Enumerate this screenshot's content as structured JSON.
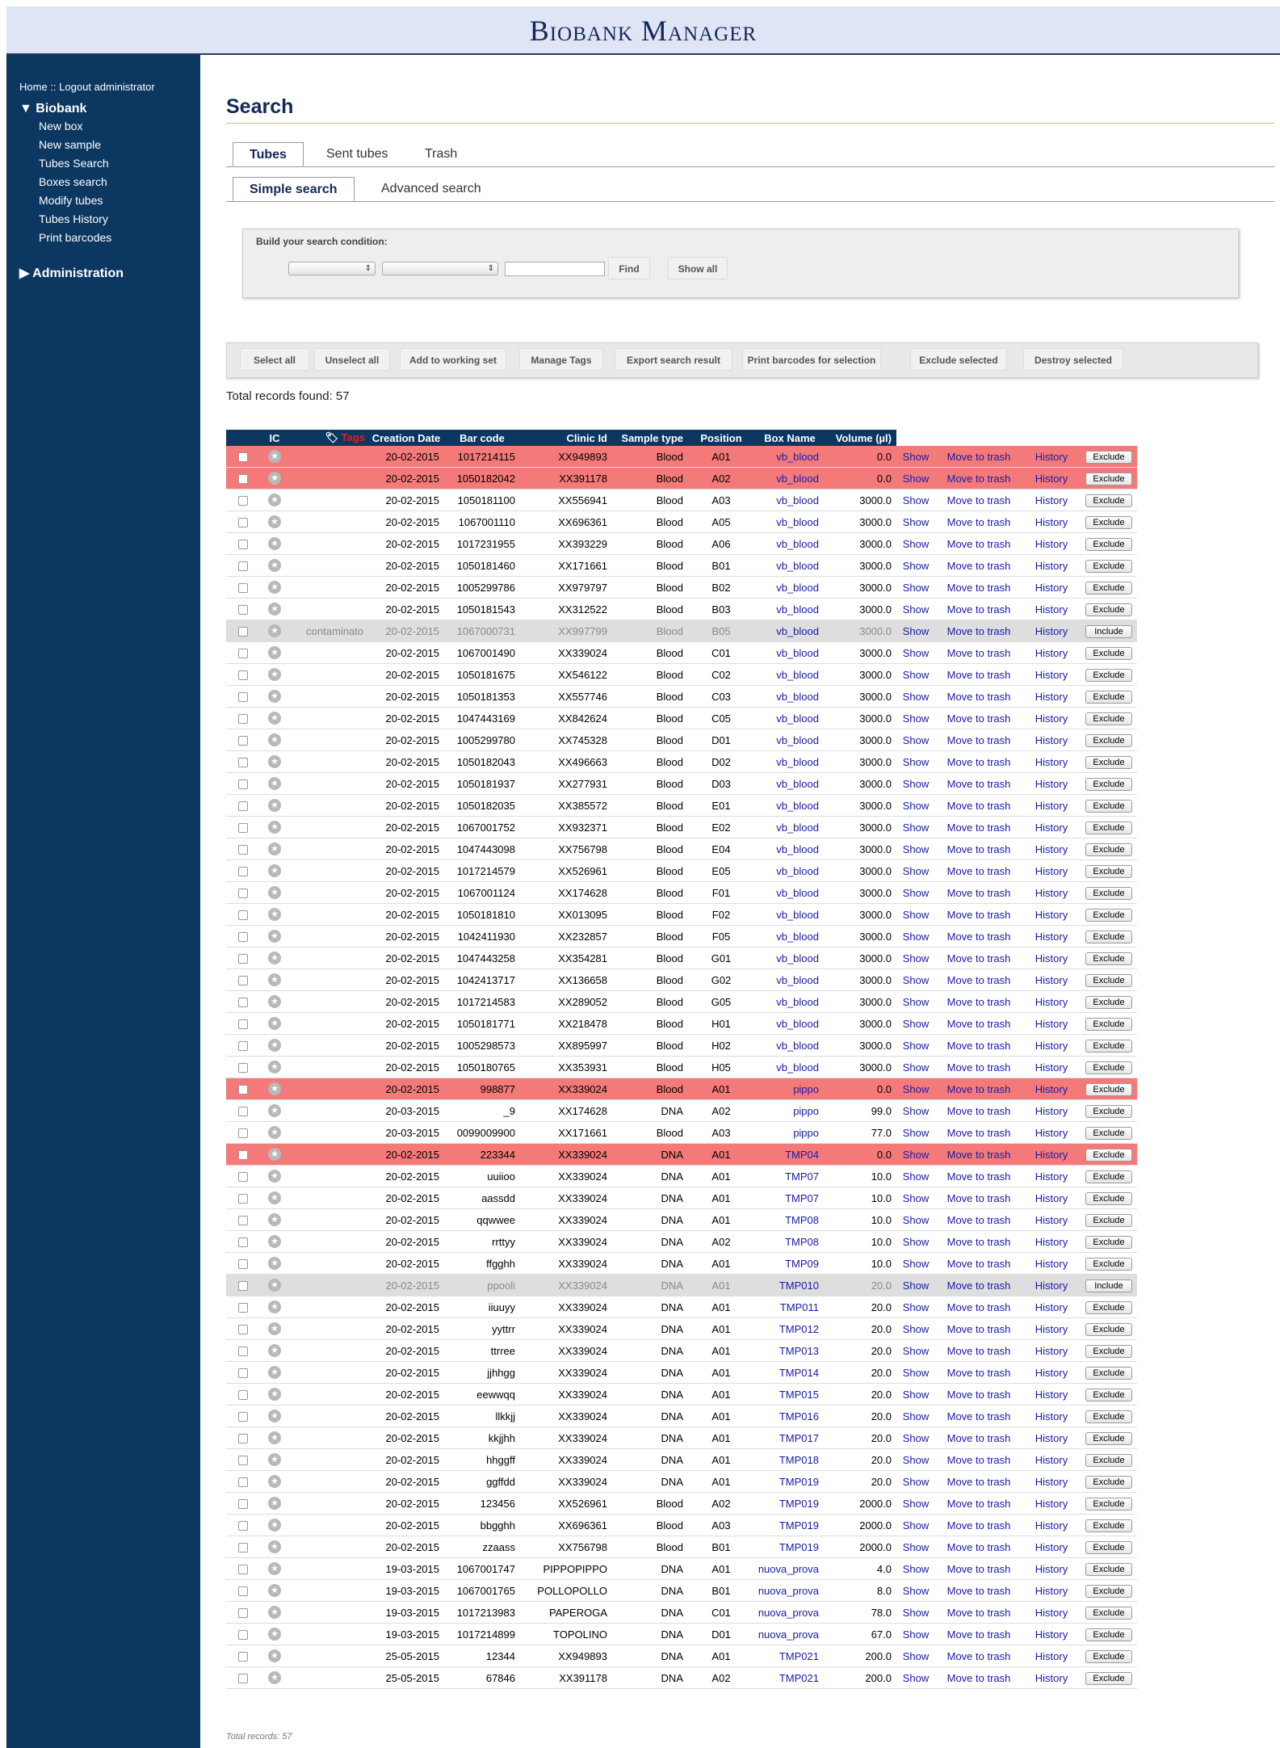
{
  "app": {
    "title": "Biobank Manager"
  },
  "sidebar": {
    "home": "Home",
    "separator": "::",
    "logout": "Logout administrator",
    "biobank": {
      "label": "▼ Biobank",
      "items": [
        "New box",
        "New sample",
        "Tubes Search",
        "Boxes search",
        "Modify tubes",
        "Tubes History",
        "Print barcodes"
      ]
    },
    "administration": {
      "label": "▶ Administration"
    }
  },
  "page": {
    "title": "Search"
  },
  "tabs": {
    "tubes": "Tubes",
    "sent": "Sent tubes",
    "trash": "Trash"
  },
  "subtabs": {
    "simple": "Simple search",
    "advanced": "Advanced search"
  },
  "search": {
    "label": "Build your search condition:",
    "select1_value": "",
    "select2_value": "",
    "text_value": "",
    "find": "Find",
    "show_all": "Show all"
  },
  "actions": [
    "Select all",
    "Unselect all",
    "Add to working set",
    "Manage Tags",
    "Export search result",
    "Print barcodes for selection",
    "Exclude selected",
    "Destroy selected"
  ],
  "total_label": "Total records found: 57",
  "columns": [
    "IC",
    "Tags",
    "Creation Date",
    "Bar code",
    "Clinic Id",
    "Sample type",
    "Position",
    "Box Name",
    "Volume (µl)"
  ],
  "row_links": {
    "show": "Show",
    "trash": "Move to trash",
    "history": "History"
  },
  "colors": {
    "header_bg": "#0b3761",
    "red_row": "#f47a7a",
    "excluded_row": "#dedede",
    "link": "#1a1aa8"
  },
  "rows": [
    [
      "20-02-2015",
      "1017214115",
      "XX949893",
      "Blood",
      "A01",
      "vb_blood",
      "0.0",
      "",
      "red",
      "Exclude"
    ],
    [
      "20-02-2015",
      "1050182042",
      "XX391178",
      "Blood",
      "A02",
      "vb_blood",
      "0.0",
      "",
      "red",
      "Exclude"
    ],
    [
      "20-02-2015",
      "1050181100",
      "XX556941",
      "Blood",
      "A03",
      "vb_blood",
      "3000.0",
      "",
      "",
      "Exclude"
    ],
    [
      "20-02-2015",
      "1067001110",
      "XX696361",
      "Blood",
      "A05",
      "vb_blood",
      "3000.0",
      "",
      "",
      "Exclude"
    ],
    [
      "20-02-2015",
      "1017231955",
      "XX393229",
      "Blood",
      "A06",
      "vb_blood",
      "3000.0",
      "",
      "",
      "Exclude"
    ],
    [
      "20-02-2015",
      "1050181460",
      "XX171661",
      "Blood",
      "B01",
      "vb_blood",
      "3000.0",
      "",
      "",
      "Exclude"
    ],
    [
      "20-02-2015",
      "1005299786",
      "XX979797",
      "Blood",
      "B02",
      "vb_blood",
      "3000.0",
      "",
      "",
      "Exclude"
    ],
    [
      "20-02-2015",
      "1050181543",
      "XX312522",
      "Blood",
      "B03",
      "vb_blood",
      "3000.0",
      "",
      "",
      "Exclude"
    ],
    [
      "20-02-2015",
      "1067000731",
      "XX997799",
      "Blood",
      "B05",
      "vb_blood",
      "3000.0",
      "contaminato",
      "gray",
      "Include"
    ],
    [
      "20-02-2015",
      "1067001490",
      "XX339024",
      "Blood",
      "C01",
      "vb_blood",
      "3000.0",
      "",
      "",
      "Exclude"
    ],
    [
      "20-02-2015",
      "1050181675",
      "XX546122",
      "Blood",
      "C02",
      "vb_blood",
      "3000.0",
      "",
      "",
      "Exclude"
    ],
    [
      "20-02-2015",
      "1050181353",
      "XX557746",
      "Blood",
      "C03",
      "vb_blood",
      "3000.0",
      "",
      "",
      "Exclude"
    ],
    [
      "20-02-2015",
      "1047443169",
      "XX842624",
      "Blood",
      "C05",
      "vb_blood",
      "3000.0",
      "",
      "",
      "Exclude"
    ],
    [
      "20-02-2015",
      "1005299780",
      "XX745328",
      "Blood",
      "D01",
      "vb_blood",
      "3000.0",
      "",
      "",
      "Exclude"
    ],
    [
      "20-02-2015",
      "1050182043",
      "XX496663",
      "Blood",
      "D02",
      "vb_blood",
      "3000.0",
      "",
      "",
      "Exclude"
    ],
    [
      "20-02-2015",
      "1050181937",
      "XX277931",
      "Blood",
      "D03",
      "vb_blood",
      "3000.0",
      "",
      "",
      "Exclude"
    ],
    [
      "20-02-2015",
      "1050182035",
      "XX385572",
      "Blood",
      "E01",
      "vb_blood",
      "3000.0",
      "",
      "",
      "Exclude"
    ],
    [
      "20-02-2015",
      "1067001752",
      "XX932371",
      "Blood",
      "E02",
      "vb_blood",
      "3000.0",
      "",
      "",
      "Exclude"
    ],
    [
      "20-02-2015",
      "1047443098",
      "XX756798",
      "Blood",
      "E04",
      "vb_blood",
      "3000.0",
      "",
      "",
      "Exclude"
    ],
    [
      "20-02-2015",
      "1017214579",
      "XX526961",
      "Blood",
      "E05",
      "vb_blood",
      "3000.0",
      "",
      "",
      "Exclude"
    ],
    [
      "20-02-2015",
      "1067001124",
      "XX174628",
      "Blood",
      "F01",
      "vb_blood",
      "3000.0",
      "",
      "",
      "Exclude"
    ],
    [
      "20-02-2015",
      "1050181810",
      "XX013095",
      "Blood",
      "F02",
      "vb_blood",
      "3000.0",
      "",
      "",
      "Exclude"
    ],
    [
      "20-02-2015",
      "1042411930",
      "XX232857",
      "Blood",
      "F05",
      "vb_blood",
      "3000.0",
      "",
      "",
      "Exclude"
    ],
    [
      "20-02-2015",
      "1047443258",
      "XX354281",
      "Blood",
      "G01",
      "vb_blood",
      "3000.0",
      "",
      "",
      "Exclude"
    ],
    [
      "20-02-2015",
      "1042413717",
      "XX136658",
      "Blood",
      "G02",
      "vb_blood",
      "3000.0",
      "",
      "",
      "Exclude"
    ],
    [
      "20-02-2015",
      "1017214583",
      "XX289052",
      "Blood",
      "G05",
      "vb_blood",
      "3000.0",
      "",
      "",
      "Exclude"
    ],
    [
      "20-02-2015",
      "1050181771",
      "XX218478",
      "Blood",
      "H01",
      "vb_blood",
      "3000.0",
      "",
      "",
      "Exclude"
    ],
    [
      "20-02-2015",
      "1005298573",
      "XX895997",
      "Blood",
      "H02",
      "vb_blood",
      "3000.0",
      "",
      "",
      "Exclude"
    ],
    [
      "20-02-2015",
      "1050180765",
      "XX353931",
      "Blood",
      "H05",
      "vb_blood",
      "3000.0",
      "",
      "",
      "Exclude"
    ],
    [
      "20-02-2015",
      "998877",
      "XX339024",
      "Blood",
      "A01",
      "pippo",
      "0.0",
      "",
      "red",
      "Exclude"
    ],
    [
      "20-03-2015",
      "_9",
      "XX174628",
      "DNA",
      "A02",
      "pippo",
      "99.0",
      "",
      "",
      "Exclude"
    ],
    [
      "20-03-2015",
      "0099009900",
      "XX171661",
      "Blood",
      "A03",
      "pippo",
      "77.0",
      "",
      "",
      "Exclude"
    ],
    [
      "20-02-2015",
      "223344",
      "XX339024",
      "DNA",
      "A01",
      "TMP04",
      "0.0",
      "",
      "red",
      "Exclude"
    ],
    [
      "20-02-2015",
      "uuiioo",
      "XX339024",
      "DNA",
      "A01",
      "TMP07",
      "10.0",
      "",
      "",
      "Exclude"
    ],
    [
      "20-02-2015",
      "aassdd",
      "XX339024",
      "DNA",
      "A01",
      "TMP07",
      "10.0",
      "",
      "",
      "Exclude"
    ],
    [
      "20-02-2015",
      "qqwwee",
      "XX339024",
      "DNA",
      "A01",
      "TMP08",
      "10.0",
      "",
      "",
      "Exclude"
    ],
    [
      "20-02-2015",
      "rrttyy",
      "XX339024",
      "DNA",
      "A02",
      "TMP08",
      "10.0",
      "",
      "",
      "Exclude"
    ],
    [
      "20-02-2015",
      "ffgghh",
      "XX339024",
      "DNA",
      "A01",
      "TMP09",
      "10.0",
      "",
      "",
      "Exclude"
    ],
    [
      "20-02-2015",
      "ppooli",
      "XX339024",
      "DNA",
      "A01",
      "TMP010",
      "20.0",
      "",
      "gray",
      "Include"
    ],
    [
      "20-02-2015",
      "iiuuyy",
      "XX339024",
      "DNA",
      "A01",
      "TMP011",
      "20.0",
      "",
      "",
      "Exclude"
    ],
    [
      "20-02-2015",
      "yyttrr",
      "XX339024",
      "DNA",
      "A01",
      "TMP012",
      "20.0",
      "",
      "",
      "Exclude"
    ],
    [
      "20-02-2015",
      "ttrree",
      "XX339024",
      "DNA",
      "A01",
      "TMP013",
      "20.0",
      "",
      "",
      "Exclude"
    ],
    [
      "20-02-2015",
      "jjhhgg",
      "XX339024",
      "DNA",
      "A01",
      "TMP014",
      "20.0",
      "",
      "",
      "Exclude"
    ],
    [
      "20-02-2015",
      "eewwqq",
      "XX339024",
      "DNA",
      "A01",
      "TMP015",
      "20.0",
      "",
      "",
      "Exclude"
    ],
    [
      "20-02-2015",
      "llkkjj",
      "XX339024",
      "DNA",
      "A01",
      "TMP016",
      "20.0",
      "",
      "",
      "Exclude"
    ],
    [
      "20-02-2015",
      "kkjjhh",
      "XX339024",
      "DNA",
      "A01",
      "TMP017",
      "20.0",
      "",
      "",
      "Exclude"
    ],
    [
      "20-02-2015",
      "hhggff",
      "XX339024",
      "DNA",
      "A01",
      "TMP018",
      "20.0",
      "",
      "",
      "Exclude"
    ],
    [
      "20-02-2015",
      "ggffdd",
      "XX339024",
      "DNA",
      "A01",
      "TMP019",
      "20.0",
      "",
      "",
      "Exclude"
    ],
    [
      "20-02-2015",
      "123456",
      "XX526961",
      "Blood",
      "A02",
      "TMP019",
      "2000.0",
      "",
      "",
      "Exclude"
    ],
    [
      "20-02-2015",
      "bbgghh",
      "XX696361",
      "Blood",
      "A03",
      "TMP019",
      "2000.0",
      "",
      "",
      "Exclude"
    ],
    [
      "20-02-2015",
      "zzaass",
      "XX756798",
      "Blood",
      "B01",
      "TMP019",
      "2000.0",
      "",
      "",
      "Exclude"
    ],
    [
      "19-03-2015",
      "1067001747",
      "PIPPOPIPPO",
      "DNA",
      "A01",
      "nuova_prova",
      "4.0",
      "",
      "",
      "Exclude"
    ],
    [
      "19-03-2015",
      "1067001765",
      "POLLOPOLLO",
      "DNA",
      "B01",
      "nuova_prova",
      "8.0",
      "",
      "",
      "Exclude"
    ],
    [
      "19-03-2015",
      "1017213983",
      "PAPEROGA",
      "DNA",
      "C01",
      "nuova_prova",
      "78.0",
      "",
      "",
      "Exclude"
    ],
    [
      "19-03-2015",
      "1017214899",
      "TOPOLINO",
      "DNA",
      "D01",
      "nuova_prova",
      "67.0",
      "",
      "",
      "Exclude"
    ],
    [
      "25-05-2015",
      "12344",
      "XX949893",
      "DNA",
      "A01",
      "TMP021",
      "200.0",
      "",
      "",
      "Exclude"
    ],
    [
      "25-05-2015",
      "67846",
      "XX391178",
      "DNA",
      "A02",
      "TMP021",
      "200.0",
      "",
      "",
      "Exclude"
    ]
  ],
  "footer": "Total records: 57"
}
